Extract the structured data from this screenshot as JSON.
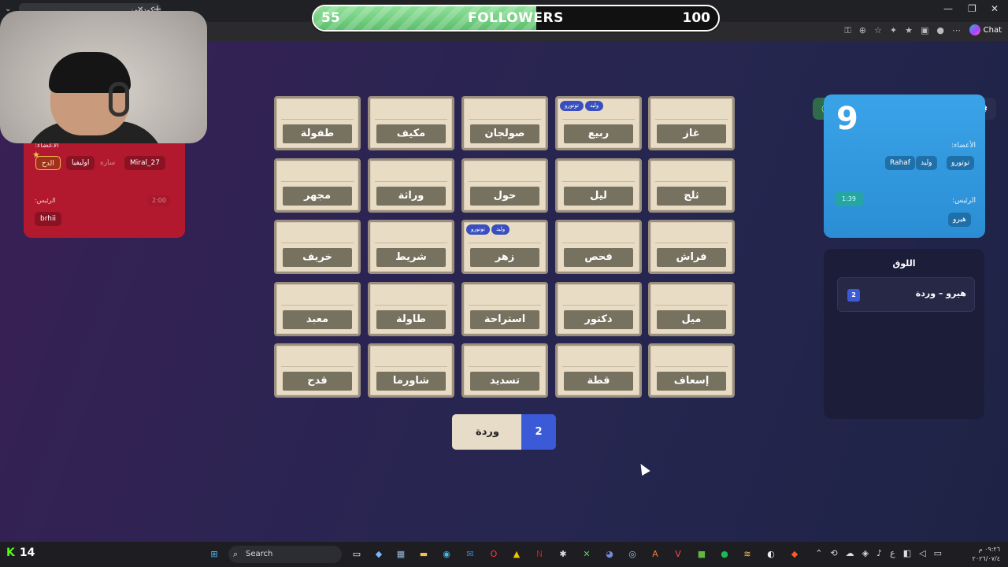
{
  "browser": {
    "tab_title": "كودنيمز",
    "new_tab": "+",
    "close_tab": "✕",
    "chat_label": "Chat",
    "window_controls": [
      "—",
      "❐",
      "✕"
    ]
  },
  "follower_goal": {
    "current": "55",
    "label": "FOLLOWERS",
    "goal": "100",
    "fill_fraction": 0.55
  },
  "top_actions": {
    "player_count": "9",
    "buttons": [
      "clock-icon",
      "emoji-icon",
      "refresh-icon",
      "users-icon",
      "gear-icon"
    ]
  },
  "red_team": {
    "members_label": ":الأعضاء",
    "members": [
      "الدح",
      "اوليفيا",
      "ساره",
      "Miral_27"
    ],
    "leader_label": ":الرئيس",
    "leader": "brhii",
    "timer": "2:00"
  },
  "blue_team": {
    "score": "9",
    "members_label": ":الأعضاء",
    "members": [
      "توتورو",
      "وليد",
      "Rahaf"
    ],
    "leader_label": ":الرئيس",
    "leader": "هيرو",
    "timer": "1:39"
  },
  "board": {
    "cards": [
      {
        "word": "طفولة",
        "tags": []
      },
      {
        "word": "مكيف",
        "tags": []
      },
      {
        "word": "صولجان",
        "tags": []
      },
      {
        "word": "ربيع",
        "tags": [
          "توتورو",
          "وليد"
        ]
      },
      {
        "word": "غاز",
        "tags": []
      },
      {
        "word": "مجهر",
        "tags": []
      },
      {
        "word": "وراثة",
        "tags": []
      },
      {
        "word": "حول",
        "tags": []
      },
      {
        "word": "ليل",
        "tags": []
      },
      {
        "word": "ثلج",
        "tags": []
      },
      {
        "word": "خريف",
        "tags": []
      },
      {
        "word": "شريط",
        "tags": []
      },
      {
        "word": "زهر",
        "tags": [
          "توتورو",
          "وليد"
        ]
      },
      {
        "word": "فحص",
        "tags": []
      },
      {
        "word": "فراش",
        "tags": []
      },
      {
        "word": "معبد",
        "tags": []
      },
      {
        "word": "طاولة",
        "tags": []
      },
      {
        "word": "استراحة",
        "tags": []
      },
      {
        "word": "دكتور",
        "tags": []
      },
      {
        "word": "ميل",
        "tags": []
      },
      {
        "word": "قدح",
        "tags": []
      },
      {
        "word": "شاورما",
        "tags": []
      },
      {
        "word": "تسديد",
        "tags": []
      },
      {
        "word": "قطة",
        "tags": []
      },
      {
        "word": "إسعاف",
        "tags": []
      }
    ]
  },
  "clue": {
    "word": "وردة",
    "number": "2"
  },
  "log": {
    "title": "اللوق",
    "entries": [
      {
        "text": "هيرو  –  وردة",
        "number": "2"
      }
    ]
  },
  "taskbar": {
    "brand_count": "14",
    "search_placeholder": "Search",
    "clock_time": "٠٩:٢٦ م",
    "clock_date": "٢٠٢٦/٠٧/٤"
  }
}
